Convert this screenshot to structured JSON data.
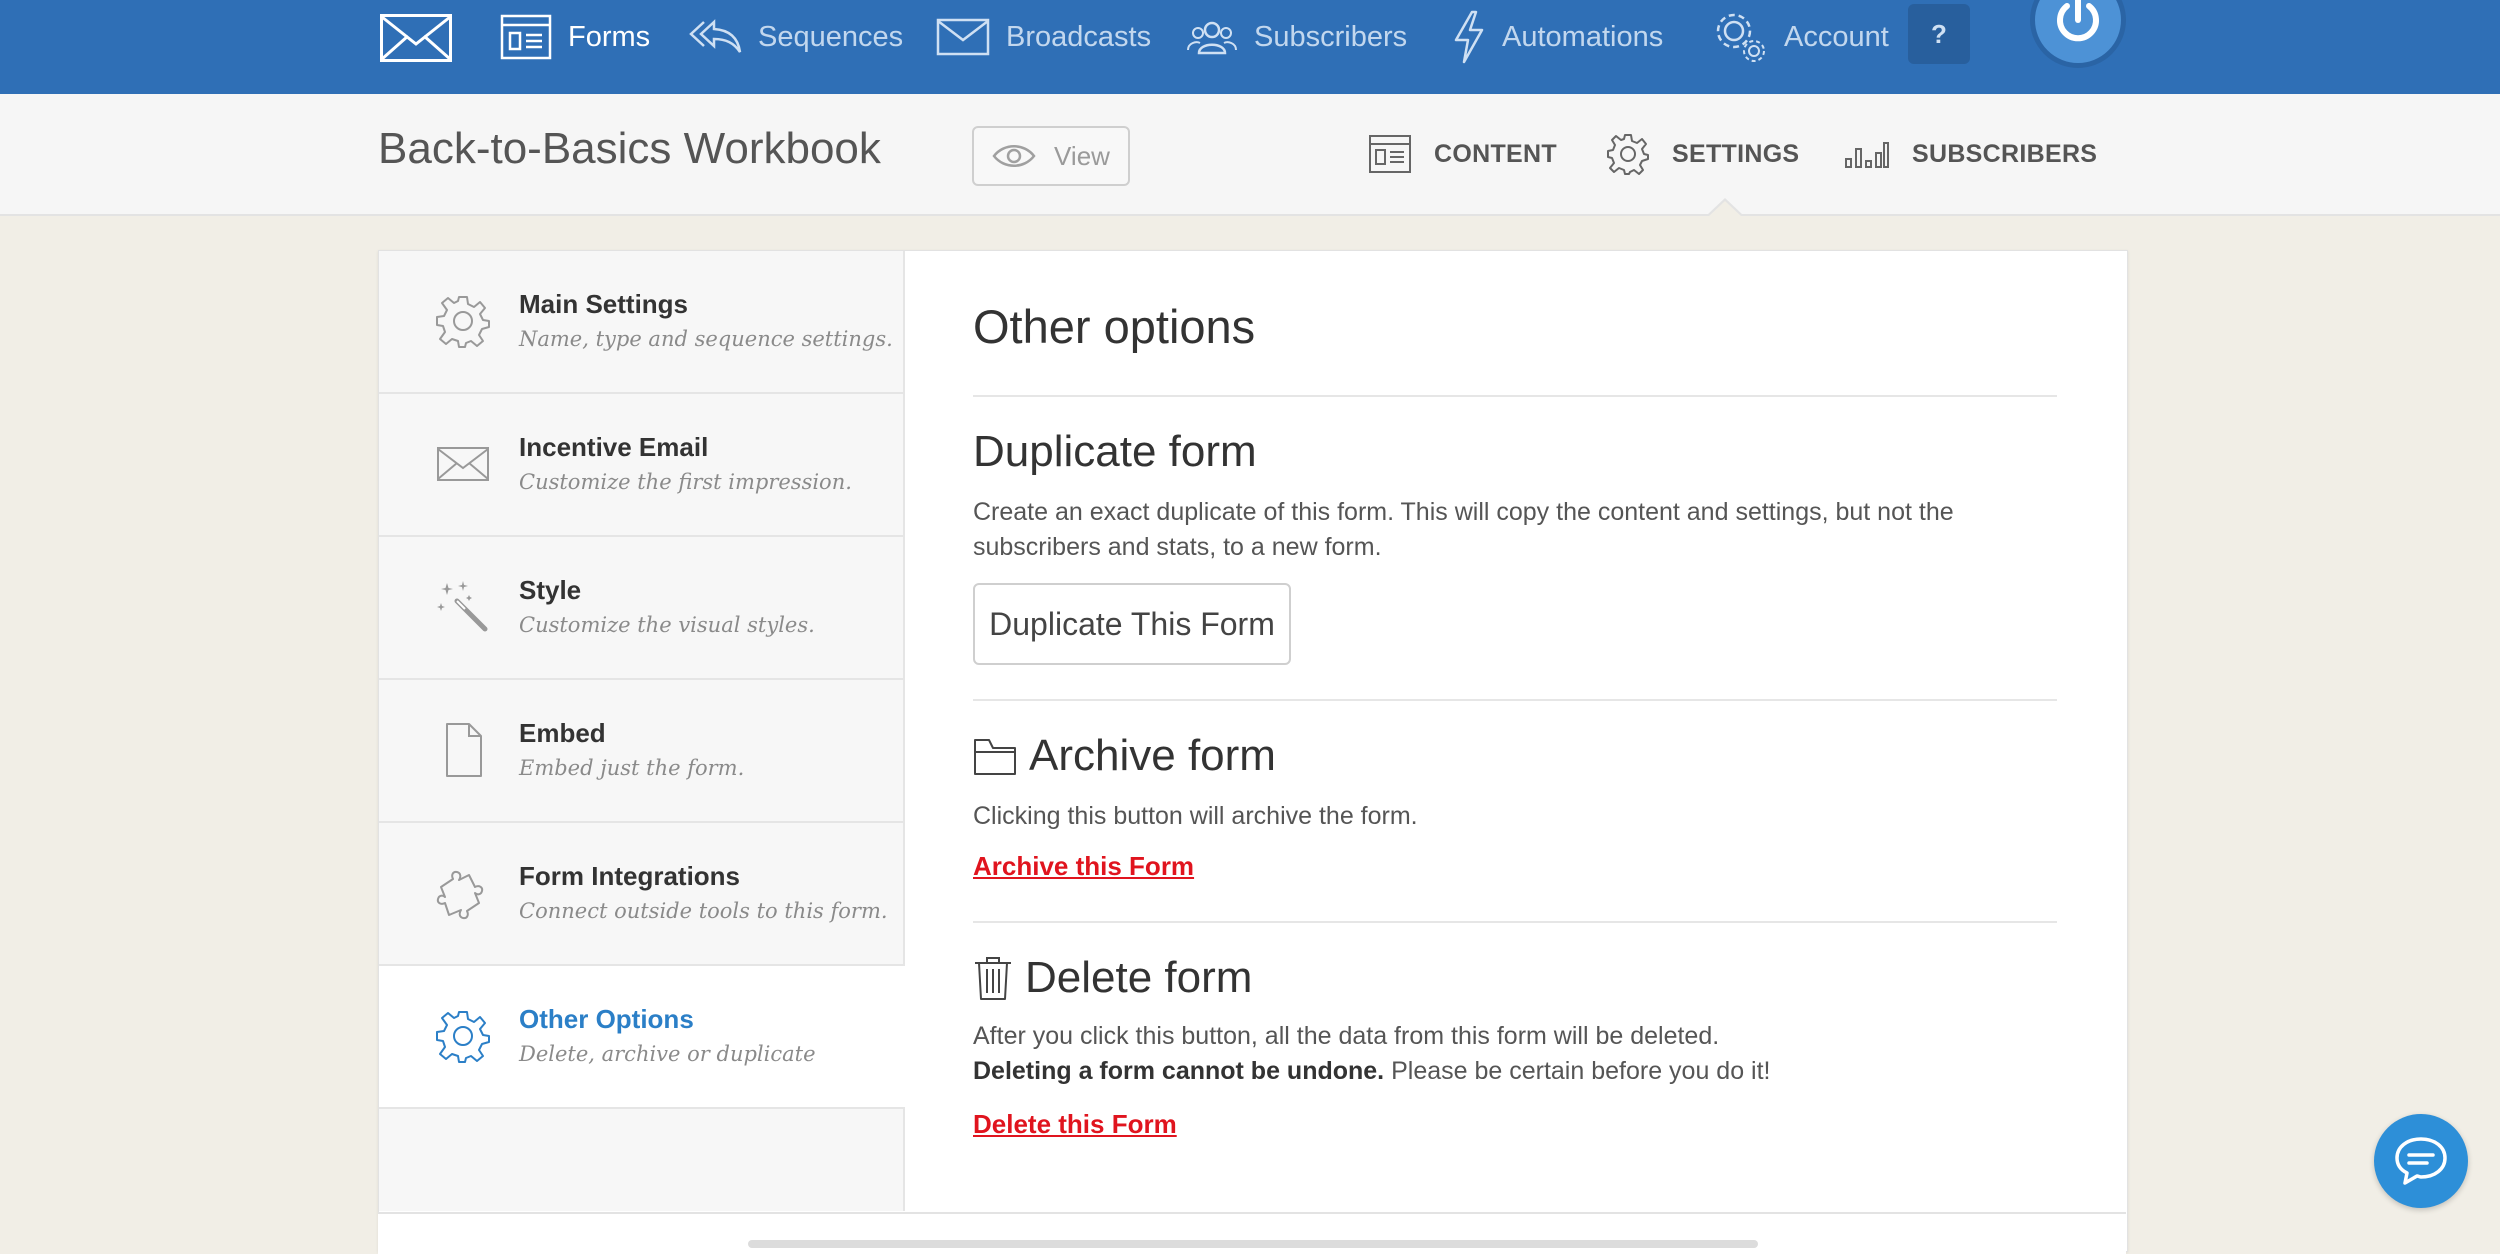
{
  "nav": {
    "items": [
      {
        "label": "Forms",
        "icon": "form-icon"
      },
      {
        "label": "Sequences",
        "icon": "reply-all-icon"
      },
      {
        "label": "Broadcasts",
        "icon": "envelope-icon"
      },
      {
        "label": "Subscribers",
        "icon": "users-icon"
      },
      {
        "label": "Automations",
        "icon": "lightning-icon"
      },
      {
        "label": "Account",
        "icon": "gears-icon"
      }
    ],
    "help_label": "?"
  },
  "header": {
    "form_title": "Back-to-Basics Workbook",
    "view_label": "View",
    "tabs": [
      {
        "label": "CONTENT",
        "icon": "form-icon"
      },
      {
        "label": "SETTINGS",
        "icon": "gear-icon"
      },
      {
        "label": "SUBSCRIBERS",
        "icon": "bar-chart-icon"
      }
    ]
  },
  "sidebar": {
    "items": [
      {
        "title": "Main Settings",
        "desc": "Name, type and sequence settings.",
        "icon": "gear-icon"
      },
      {
        "title": "Incentive Email",
        "desc": "Customize the first impression.",
        "icon": "envelope-icon"
      },
      {
        "title": "Style",
        "desc": "Customize the visual styles.",
        "icon": "magic-wand-icon"
      },
      {
        "title": "Embed",
        "desc": "Embed just the form.",
        "icon": "document-icon"
      },
      {
        "title": "Form Integrations",
        "desc": "Connect outside tools to this form.",
        "icon": "puzzle-icon"
      },
      {
        "title": "Other Options",
        "desc": "Delete, archive or duplicate",
        "icon": "gear-icon"
      }
    ]
  },
  "main": {
    "heading": "Other options",
    "duplicate": {
      "title": "Duplicate form",
      "text": "Create an exact duplicate of this form. This will copy the content and settings, but not the subscribers and stats, to a new form.",
      "button": "Duplicate This Form"
    },
    "archive": {
      "title": "Archive form",
      "text": "Clicking this button will archive the form.",
      "link": "Archive this Form"
    },
    "delete": {
      "title": "Delete form",
      "text": "After you click this button, all the data from this form will be deleted.",
      "warning_bold": "Deleting a form cannot be undone.",
      "warning_rest": " Please be certain before you do it!",
      "link": "Delete this Form"
    }
  },
  "colors": {
    "nav_bg": "#2f6fb6",
    "accent": "#2b7fc7",
    "danger": "#e0141e"
  }
}
